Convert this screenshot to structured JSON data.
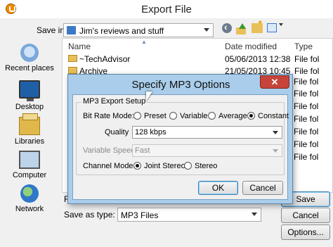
{
  "window": {
    "title": "Export File"
  },
  "save_in": {
    "label": "Save in:",
    "value": "Jim's reviews and stuff"
  },
  "places": [
    {
      "label": "Recent places",
      "icon": "recent-places-icon"
    },
    {
      "label": "Desktop",
      "icon": "desktop-icon"
    },
    {
      "label": "Libraries",
      "icon": "libraries-icon"
    },
    {
      "label": "Computer",
      "icon": "computer-icon"
    },
    {
      "label": "Network",
      "icon": "network-icon"
    }
  ],
  "file_list": {
    "columns": [
      "Name",
      "Date modified",
      "Type"
    ],
    "rows": [
      {
        "name": "~TechAdvisor",
        "date": "05/06/2013 12:38",
        "type": "File fol"
      },
      {
        "name": "Archive",
        "date": "21/05/2013 10:45",
        "type": "File fol"
      }
    ],
    "hidden_types": [
      "File fol",
      "File fol",
      "File fol",
      "File fol",
      "File fol",
      "File fol",
      "File fol"
    ]
  },
  "bottom": {
    "filename_label": "F",
    "save_as_type_label": "Save as type:",
    "save_as_type_value": "MP3 Files",
    "save_button": "Save",
    "cancel_button": "Cancel",
    "options_button": "Options..."
  },
  "mp3_dialog": {
    "title": "Specify MP3 Options",
    "close_glyph": "✕",
    "group_title": "MP3 Export Setup",
    "bit_rate_label": "Bit Rate Mode:",
    "bit_rate_options": [
      "Preset",
      "Variable",
      "Average",
      "Constant"
    ],
    "bit_rate_selected": "Constant",
    "quality_label": "Quality",
    "quality_value": "128 kbps",
    "variable_speed_label": "Variable Speed:",
    "variable_speed_value": "Fast",
    "channel_label": "Channel Mode:",
    "channel_options": [
      "Joint Stereo",
      "Stereo"
    ],
    "channel_selected": "Joint Stereo",
    "ok_button": "OK",
    "cancel_button": "Cancel"
  }
}
